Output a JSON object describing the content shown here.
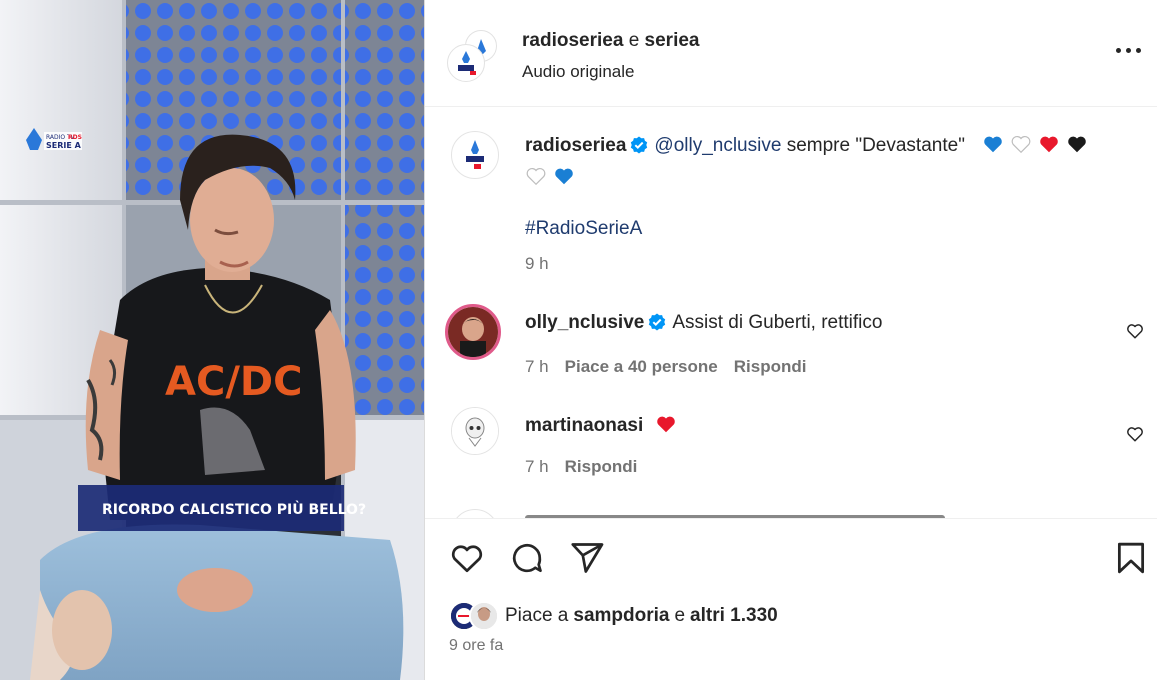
{
  "media": {
    "overlay_caption": "RICORDO CALCISTICO PIÙ BELLO?",
    "logo_lines": [
      "RADIO TV",
      "SERIE A",
      "RDS"
    ],
    "shirt_text": "AC/DC"
  },
  "header": {
    "user": "radioseriea",
    "joiner": "e",
    "collab": "seriea",
    "subtitle": "Audio originale"
  },
  "caption": {
    "user": "radioseriea",
    "mention": "@olly_nclusive",
    "text": "sempre \"Devastante\"",
    "hashtag": "#RadioSerieA",
    "time": "9 h"
  },
  "comments": [
    {
      "user": "olly_nclusive",
      "verified": true,
      "text": "Assist di Guberti, rettifico",
      "time": "7 h",
      "likes": "Piace a 40 persone",
      "reply": "Rispondi"
    },
    {
      "user": "martinaonasi",
      "verified": false,
      "text": "",
      "time": "7 h",
      "reply": "Rispondi"
    }
  ],
  "likes_line": {
    "prefix": "Piace a",
    "user": "sampdoria",
    "joiner": "e",
    "others": "altri 1.330"
  },
  "post_time": "9 ore fa",
  "colors": {
    "verified": "#0095f6",
    "link": "#1f3b6e",
    "muted": "#737373",
    "red_heart": "#e8182c",
    "blue_heart": "#1a7fd4"
  },
  "icons": [
    "heart-icon",
    "comment-icon",
    "share-icon",
    "bookmark-icon",
    "more-icon",
    "verified-icon"
  ]
}
